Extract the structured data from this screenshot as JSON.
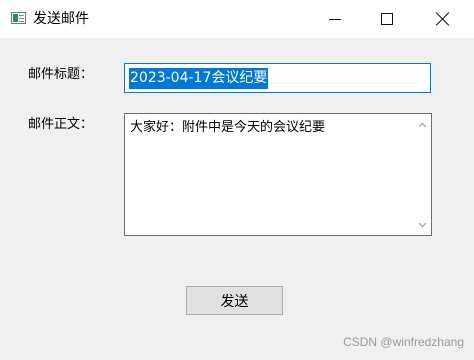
{
  "window": {
    "title": "发送邮件",
    "icon": "window-app-icon"
  },
  "form": {
    "subject_label": "邮件标题：",
    "subject_value": "2023-04-17会议纪要",
    "body_label": "邮件正文：",
    "body_value": "大家好：附件中是今天的会议纪要"
  },
  "actions": {
    "send_label": "发送"
  },
  "watermark": {
    "text": "CSDN @winfredzhang"
  },
  "colors": {
    "selection": "#0078d7",
    "focus_border": "#0078d7",
    "window_bg": "#f0f0f0",
    "button_bg": "#e1e1e1"
  }
}
